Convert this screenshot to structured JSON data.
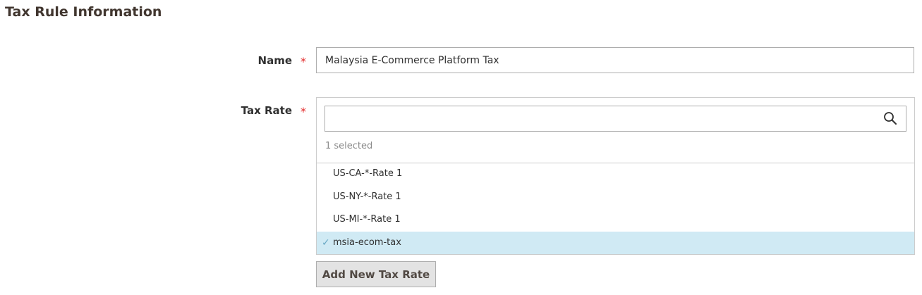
{
  "section": {
    "title": "Tax Rule Information"
  },
  "name_field": {
    "label": "Name",
    "required_mark": "*",
    "value": "Malaysia E-Commerce Platform Tax"
  },
  "tax_rate_field": {
    "label": "Tax Rate",
    "required_mark": "*",
    "search_value": "",
    "search_icon": "search-icon",
    "selected_count": "1 selected",
    "options": [
      {
        "label": "US-CA-*-Rate 1",
        "selected": false
      },
      {
        "label": "US-NY-*-Rate 1",
        "selected": false
      },
      {
        "label": "US-MI-*-Rate 1",
        "selected": false
      },
      {
        "label": "msia-ecom-tax",
        "selected": true
      }
    ],
    "check_glyph": "✓"
  },
  "add_button": {
    "label": "Add New Tax Rate"
  },
  "colors": {
    "required": "#e22626",
    "selected_row": "#d0eaf4",
    "check": "#6aa9c5"
  }
}
